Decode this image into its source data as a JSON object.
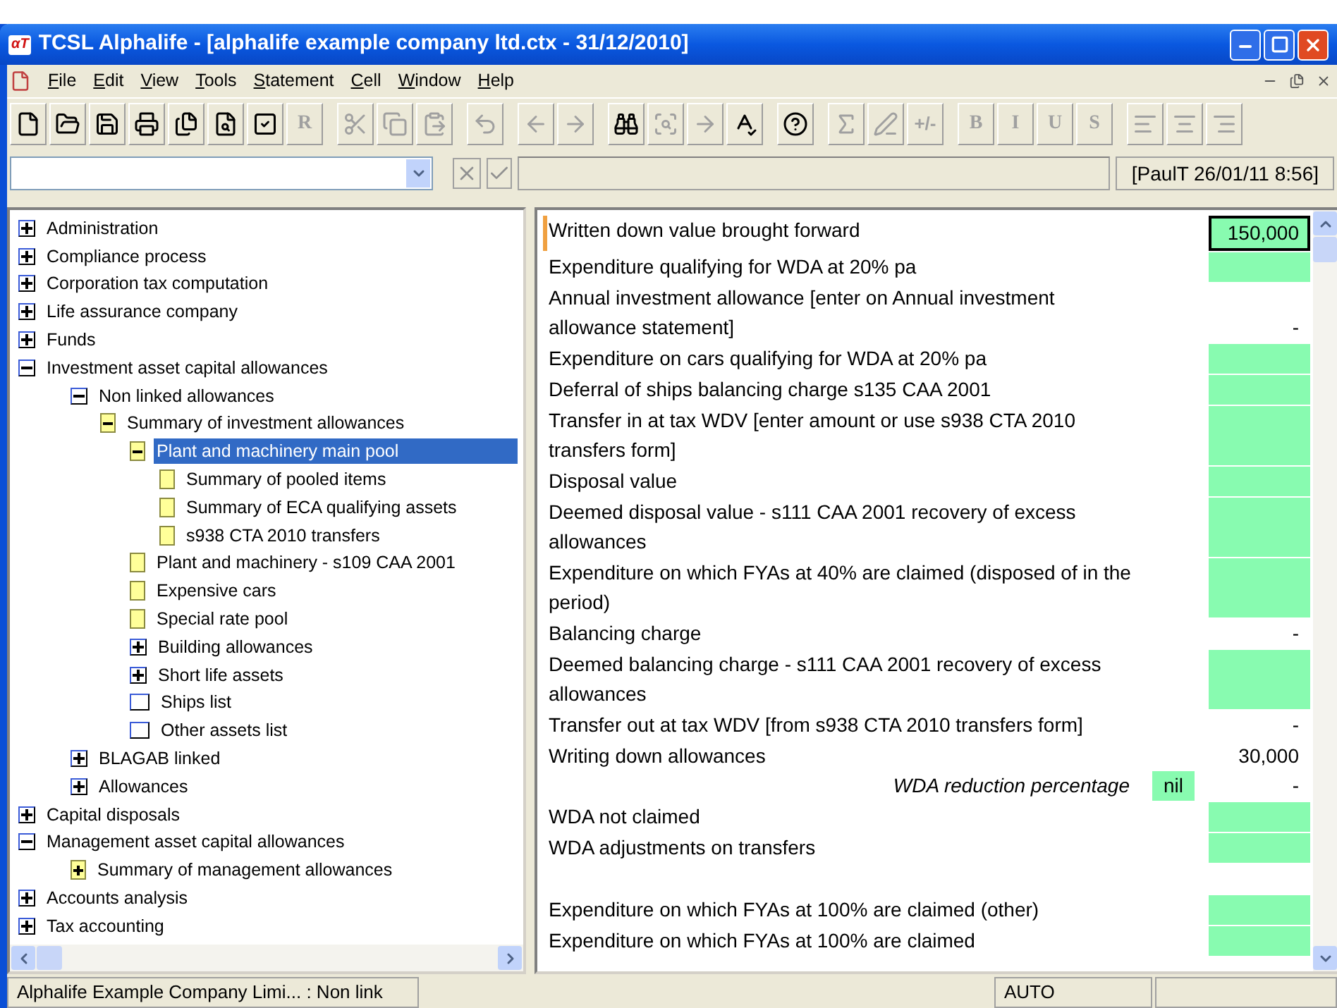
{
  "window": {
    "logo": "αT",
    "title": "TCSL Alphalife - [alphalife example company ltd.ctx - 31/12/2010]"
  },
  "menu": [
    "File",
    "Edit",
    "View",
    "Tools",
    "Statement",
    "Cell",
    "Window",
    "Help"
  ],
  "toolbar": [
    {
      "kind": "new",
      "disabled": false
    },
    {
      "kind": "open",
      "disabled": false
    },
    {
      "kind": "save",
      "disabled": false
    },
    {
      "kind": "print",
      "disabled": false
    },
    {
      "kind": "pages",
      "disabled": false
    },
    {
      "kind": "preview",
      "disabled": false
    },
    {
      "kind": "check",
      "disabled": false
    },
    {
      "kind": "letter",
      "label": "R",
      "disabled": true
    },
    {
      "kind": "sep"
    },
    {
      "kind": "cut",
      "disabled": true
    },
    {
      "kind": "copy",
      "disabled": true
    },
    {
      "kind": "paste",
      "disabled": true
    },
    {
      "kind": "sep"
    },
    {
      "kind": "undo",
      "disabled": true
    },
    {
      "kind": "sep"
    },
    {
      "kind": "left",
      "disabled": true
    },
    {
      "kind": "right",
      "disabled": true
    },
    {
      "kind": "sep"
    },
    {
      "kind": "find",
      "disabled": false
    },
    {
      "kind": "findnext",
      "disabled": true
    },
    {
      "kind": "goto",
      "disabled": true
    },
    {
      "kind": "spell",
      "disabled": false
    },
    {
      "kind": "sep"
    },
    {
      "kind": "help",
      "disabled": false
    },
    {
      "kind": "sep"
    },
    {
      "kind": "sum",
      "disabled": true
    },
    {
      "kind": "pen",
      "disabled": true
    },
    {
      "kind": "letter",
      "label": "+/-",
      "disabled": true
    },
    {
      "kind": "sep"
    },
    {
      "kind": "letter",
      "label": "B",
      "disabled": true
    },
    {
      "kind": "letter",
      "label": "I",
      "disabled": true
    },
    {
      "kind": "letter",
      "label": "U",
      "disabled": true
    },
    {
      "kind": "letter",
      "label": "S",
      "disabled": true
    },
    {
      "kind": "sep"
    },
    {
      "kind": "alignleft",
      "disabled": true
    },
    {
      "kind": "aligncenter",
      "disabled": true
    },
    {
      "kind": "alignright",
      "disabled": true
    }
  ],
  "formula_bar": {
    "stamp": "[PaulT 26/01/11 8:56]"
  },
  "tree": [
    {
      "label": "Administration",
      "kind": "plus",
      "selected": false
    },
    {
      "label": "Compliance process",
      "kind": "plus",
      "selected": false
    },
    {
      "label": "Corporation tax computation",
      "kind": "plus",
      "selected": false
    },
    {
      "label": "Life assurance company",
      "kind": "plus",
      "selected": false
    },
    {
      "label": "Funds",
      "kind": "plus",
      "selected": false
    },
    {
      "label": "Investment asset capital allowances",
      "kind": "minus",
      "selected": false,
      "children": [
        {
          "label": "Non linked allowances",
          "kind": "minus",
          "selected": false,
          "children": [
            {
              "label": "Summary of investment allowances",
              "kind": "page-minus",
              "selected": false,
              "children": [
                {
                  "label": "Plant and machinery main pool",
                  "kind": "page-minus",
                  "selected": true,
                  "children": [
                    {
                      "label": "Summary of pooled items",
                      "kind": "page",
                      "selected": false
                    },
                    {
                      "label": "Summary of ECA qualifying assets",
                      "kind": "page",
                      "selected": false
                    },
                    {
                      "label": "s938 CTA 2010 transfers",
                      "kind": "page",
                      "selected": false
                    }
                  ]
                },
                {
                  "label": "Plant and machinery - s109 CAA 2001",
                  "kind": "page",
                  "selected": false
                },
                {
                  "label": "Expensive cars",
                  "kind": "page",
                  "selected": false
                },
                {
                  "label": "Special rate pool",
                  "kind": "page",
                  "selected": false
                },
                {
                  "label": "Building allowances",
                  "kind": "plus",
                  "selected": false
                },
                {
                  "label": "Short life assets",
                  "kind": "plus",
                  "selected": false
                },
                {
                  "label": "Ships list",
                  "kind": "box",
                  "selected": false
                },
                {
                  "label": "Other assets list",
                  "kind": "box",
                  "selected": false
                }
              ]
            }
          ]
        },
        {
          "label": "BLAGAB linked",
          "kind": "plus",
          "selected": false
        },
        {
          "label": "Allowances",
          "kind": "plus",
          "selected": false
        }
      ]
    },
    {
      "label": "Capital disposals",
      "kind": "plus",
      "selected": false
    },
    {
      "label": "Management asset capital allowances",
      "kind": "minus",
      "selected": false,
      "children": [
        {
          "label": "Summary of management allowances",
          "kind": "page-plus",
          "selected": false
        }
      ]
    },
    {
      "label": "Accounts analysis",
      "kind": "plus",
      "selected": false
    },
    {
      "label": "Tax accounting",
      "kind": "plus",
      "selected": false
    }
  ],
  "rows": [
    {
      "kind": "line",
      "label": "Written down value brought forward",
      "input": true,
      "focused": true,
      "value": "150,000"
    },
    {
      "kind": "line",
      "label": "Expenditure qualifying for WDA at 20% pa",
      "input": true,
      "focused": false
    },
    {
      "kind": "line",
      "label": "Annual investment allowance [enter on Annual investment allowance statement]",
      "input": false,
      "value": "-"
    },
    {
      "kind": "line",
      "label": "Expenditure on cars qualifying for WDA at 20% pa",
      "input": true,
      "focused": false
    },
    {
      "kind": "line",
      "label": "Deferral of ships balancing charge s135 CAA 2001",
      "input": true,
      "focused": false
    },
    {
      "kind": "line",
      "label": "Transfer in at tax WDV [enter amount or use s938 CTA 2010 transfers form]",
      "input": true,
      "focused": false
    },
    {
      "kind": "line",
      "label": "Disposal value",
      "input": true,
      "focused": false
    },
    {
      "kind": "line",
      "label": "Deemed disposal value - s111 CAA 2001 recovery of excess allowances",
      "input": true,
      "focused": false
    },
    {
      "kind": "line",
      "label": "Expenditure on which FYAs at 40% are claimed (disposed of in the period)",
      "input": true,
      "focused": false
    },
    {
      "kind": "line",
      "label": "Balancing charge",
      "input": false,
      "value": "-"
    },
    {
      "kind": "line",
      "label": "Deemed balancing charge - s111 CAA 2001 recovery of excess allowances",
      "input": true,
      "focused": false
    },
    {
      "kind": "line",
      "label": "Transfer out at tax WDV [from s938 CTA 2010 transfers form]",
      "input": false,
      "value": "-"
    },
    {
      "kind": "line",
      "label": "Writing down allowances",
      "input": false,
      "value": "30,000"
    },
    {
      "kind": "sub",
      "label": "WDA reduction percentage",
      "tag": "nil",
      "value": "-"
    },
    {
      "kind": "line",
      "label": "WDA not claimed",
      "input": true,
      "focused": false
    },
    {
      "kind": "line",
      "label": "WDA adjustments on transfers",
      "input": true,
      "focused": false
    },
    {
      "kind": "blank"
    },
    {
      "kind": "line",
      "label": "Expenditure on which FYAs at 100% are claimed (other)",
      "input": true,
      "focused": false
    },
    {
      "kind": "line",
      "label": "Expenditure on which FYAs at 100% are claimed",
      "input": true,
      "focused": false
    }
  ],
  "status_bar": [
    "Alphalife Example Company Limi... : Non link",
    "AUTO"
  ]
}
